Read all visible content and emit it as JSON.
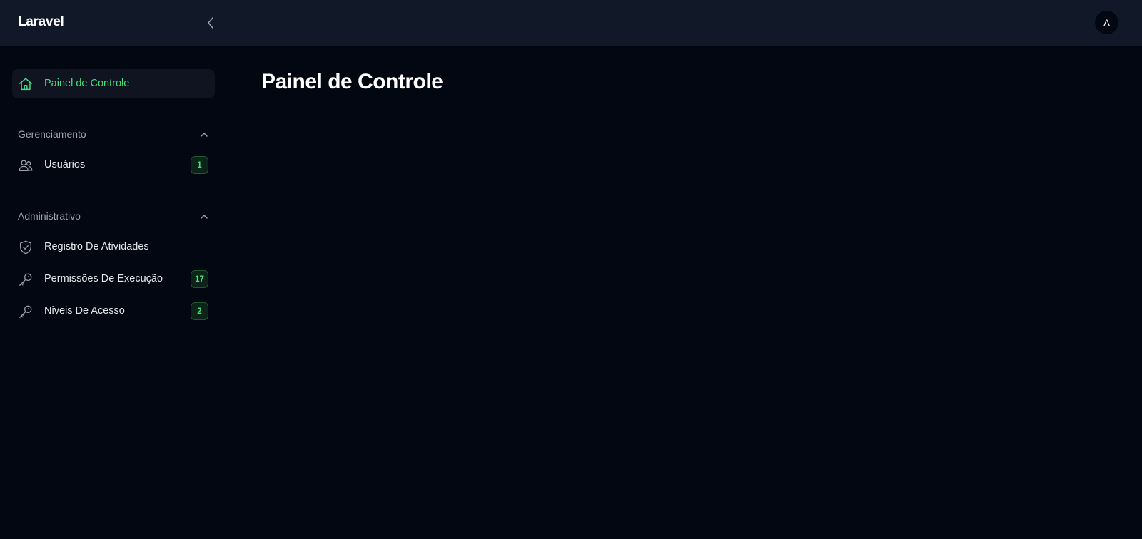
{
  "app": {
    "brand": "Laravel",
    "avatar_initial": "A"
  },
  "sidebar": {
    "dashboard": {
      "label": "Painel de Controle",
      "icon": "home-icon",
      "active": true
    },
    "groups": [
      {
        "label": "Gerenciamento",
        "expanded": true,
        "items": [
          {
            "label": "Usuários",
            "icon": "users-icon",
            "badge": "1"
          }
        ]
      },
      {
        "label": "Administrativo",
        "expanded": true,
        "items": [
          {
            "label": "Registro De Atividades",
            "icon": "shield-check-icon",
            "badge": ""
          },
          {
            "label": "Permissões De Execução",
            "icon": "key-icon",
            "badge": "17"
          },
          {
            "label": "Niveis De Acesso",
            "icon": "key-icon",
            "badge": "2"
          }
        ]
      }
    ]
  },
  "main": {
    "title": "Painel de Controle"
  },
  "colors": {
    "accent": "#4ade80",
    "background": "#030712",
    "topbar": "#111827",
    "muted_text": "#9ca3af"
  }
}
